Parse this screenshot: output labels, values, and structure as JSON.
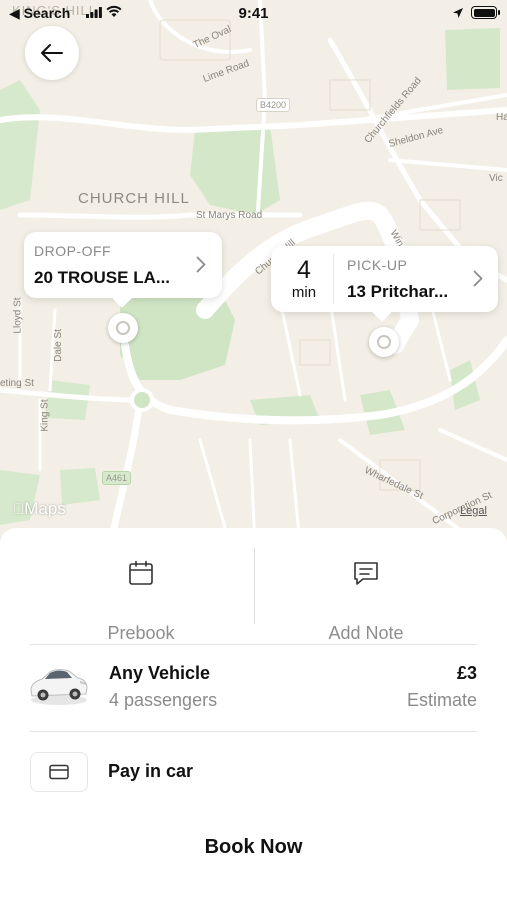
{
  "status_bar": {
    "back_app": "◀ Search",
    "time": "9:41"
  },
  "map": {
    "labels": {
      "kings_hill": "KING'S HILL",
      "the_oval": "The Oval",
      "lime_road": "Lime Road",
      "b4200": "B4200",
      "churchfields": "Churchfields Road",
      "sheldon": "Sheldon Ave",
      "church_hill_area": "CHURCH HILL",
      "st_marys": "St Marys Road",
      "church_hill_road": "Church Hill",
      "win": "Win",
      "vic": "Vic",
      "ha": "Ha",
      "lloyd": "Lloyd St",
      "dale": "Dale St",
      "king_st": "King St",
      "eting_st": "eting St",
      "a461": "A461",
      "wharfedale": "Wharfedale St",
      "corporation": "Corporation St"
    },
    "attribution": "Maps",
    "legal": "Legal"
  },
  "dropoff": {
    "caption": "DROP-OFF",
    "address": "20 TROUSE LA..."
  },
  "pickup": {
    "eta_value": "4",
    "eta_unit": "min",
    "caption": "PICK-UP",
    "address": "13 Pritchar..."
  },
  "options": {
    "prebook": "Prebook",
    "add_note": "Add Note"
  },
  "vehicle": {
    "name": "Any Vehicle",
    "passengers": "4 passengers",
    "price": "£3",
    "price_note": "Estimate"
  },
  "payment": {
    "label": "Pay in car"
  },
  "book_button": "Book Now",
  "colors": {
    "map_background": "#f3efe6",
    "park_green": "#cfe5c4",
    "road": "#ffffff",
    "muted_text": "#8e8e8e"
  }
}
